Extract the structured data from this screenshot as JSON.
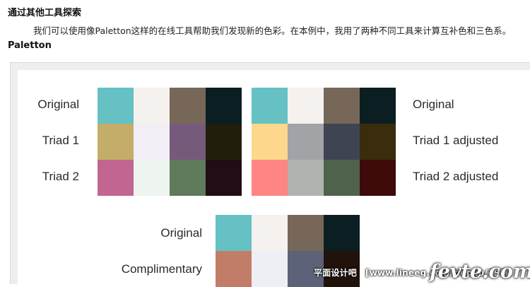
{
  "article": {
    "heading": "通过其他工具探索",
    "paragraph": "我们可以使用像Paletton这样的在线工具帮助我们发现新的色彩。在本例中，我用了两种不同工具来计算互补色和三色系。",
    "subheading": "Paletton"
  },
  "figure": {
    "left_labels": [
      "Original",
      "Triad 1",
      "Triad 2"
    ],
    "right_labels": [
      "Original",
      "Triad 1 adjusted",
      "Triad 2 adjusted"
    ],
    "bottom_labels": [
      "Original",
      "Complimentary"
    ],
    "left_grid": [
      [
        "#65c1c4",
        "#f5f1ee",
        "#776758",
        "#0b1f23"
      ],
      [
        "#c4ad68",
        "#f2eef5",
        "#765a7b",
        "#221e0c"
      ],
      [
        "#c26590",
        "#edf5ee",
        "#5f7b5c",
        "#220c16"
      ]
    ],
    "right_grid": [
      [
        "#65c1c4",
        "#f5f1ee",
        "#776758",
        "#0b1f23"
      ],
      [
        "#fdd88c",
        "#a2a3a7",
        "#3e4452",
        "#3a2c0c"
      ],
      [
        "#fd8584",
        "#b0b3b0",
        "#4f634c",
        "#3e0a0a"
      ]
    ],
    "bottom_grid": [
      [
        "#65c1c4",
        "#f5f1ee",
        "#776758",
        "#0b1f23"
      ],
      [
        "#c27d68",
        "#eeeef5",
        "#5c6278",
        "#22120c"
      ]
    ]
  },
  "watermark": {
    "site_cn": "平面设计吧",
    "site_url": "[www.lineeg.com/tiebeu/1922",
    "logo_text": "fevte.com"
  }
}
